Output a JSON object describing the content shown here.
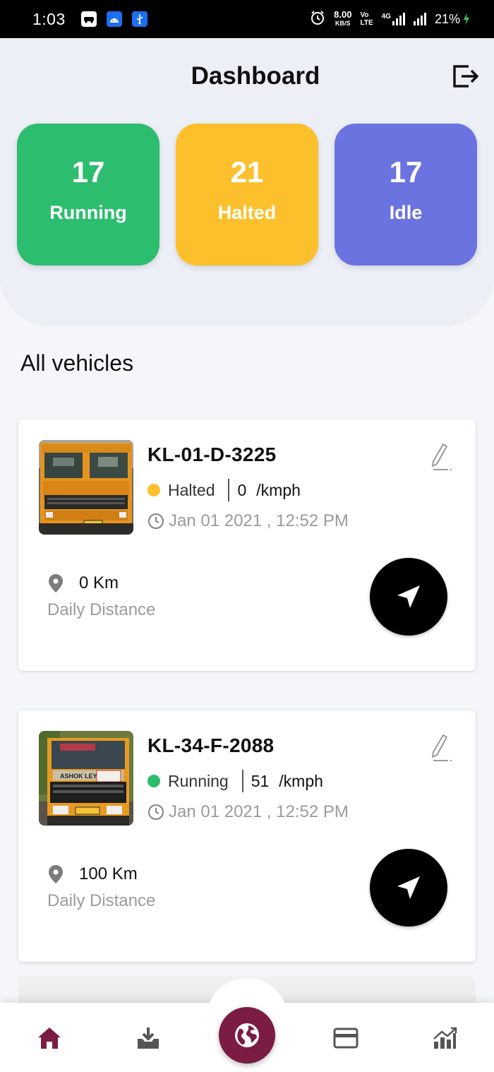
{
  "status_bar": {
    "time": "1:03",
    "net_speed": "8.00",
    "net_unit": "KB/S",
    "volte_top": "Vo",
    "volte_bottom": "LTE",
    "network_type": "4G",
    "battery": "21%"
  },
  "header": {
    "title": "Dashboard",
    "logout_icon": "logout-icon"
  },
  "summary": [
    {
      "count": "17",
      "label": "Running",
      "color": "#2dbd6e"
    },
    {
      "count": "21",
      "label": "Halted",
      "color": "#fcc02d"
    },
    {
      "count": "17",
      "label": "Idle",
      "color": "#6b73e0"
    }
  ],
  "section": {
    "title": "All vehicles"
  },
  "vehicles": [
    {
      "plate": "KL-01-D-3225",
      "status": "Halted",
      "status_color": "#fcc02d",
      "speed": "0",
      "speed_unit": "/kmph",
      "timestamp": "Jan 01 2021  , 12:52 PM",
      "distance": "0 Km",
      "distance_label": "Daily Distance"
    },
    {
      "plate": "KL-34-F-2088",
      "status": "Running",
      "status_color": "#2dbd6e",
      "speed": "51",
      "speed_unit": "/kmph",
      "timestamp": "Jan 01 2021  , 12:52 PM",
      "distance": "100 Km",
      "distance_label": "Daily Distance"
    }
  ],
  "bottom_nav": {
    "items": [
      "home-icon",
      "download-icon",
      "globe-icon",
      "card-icon",
      "analytics-icon"
    ],
    "active_color": "#7b1c45",
    "fab_color": "#7b1c45"
  }
}
